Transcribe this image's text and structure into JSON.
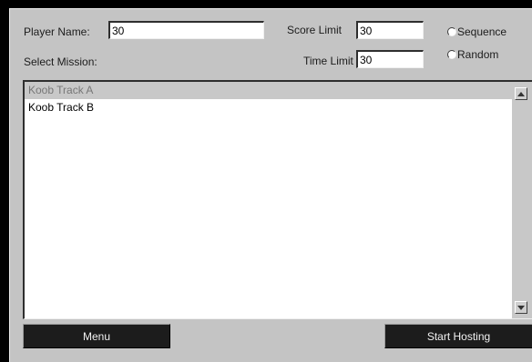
{
  "form": {
    "player_name_label": "Player Name:",
    "player_name_value": "30",
    "select_mission_label": "Select Mission:",
    "score_limit_label": "Score Limit",
    "score_limit_value": "30",
    "time_limit_label": "Time Limit",
    "time_limit_value": "30"
  },
  "mode": {
    "options": [
      "Sequence",
      "Random"
    ]
  },
  "missions": {
    "items": [
      "Koob Track A",
      "Koob Track B"
    ],
    "selected_index": 0
  },
  "buttons": {
    "menu": "Menu",
    "start_hosting": "Start Hosting"
  }
}
